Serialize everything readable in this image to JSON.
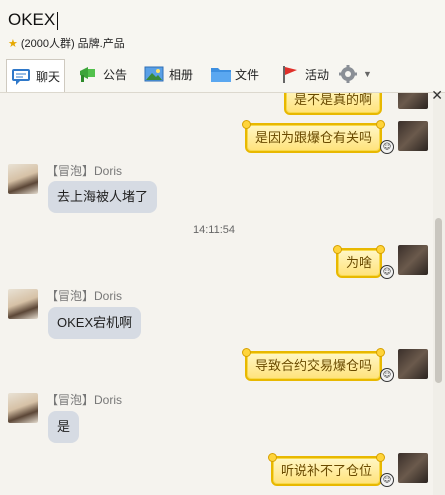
{
  "window": {
    "group_name": "OKEX",
    "member_count": "(2000人群)",
    "group_tags": "品牌.产品"
  },
  "toolbar": {
    "items": [
      {
        "label": "聊天",
        "icon": "chat-icon"
      },
      {
        "label": "公告",
        "icon": "announcement-icon"
      },
      {
        "label": "相册",
        "icon": "photo-album-icon"
      },
      {
        "label": "文件",
        "icon": "folder-icon"
      },
      {
        "label": "活动",
        "icon": "flag-icon"
      }
    ],
    "settings_icon": "gear-icon"
  },
  "messages": [
    {
      "side": "right",
      "text": "是不是真的啊"
    },
    {
      "side": "right",
      "text": "是因为跟爆仓有关吗"
    },
    {
      "side": "left",
      "sender": "【冒泡】Doris",
      "text": "去上海被人堵了"
    },
    {
      "side": "time",
      "text": "14:11:54"
    },
    {
      "side": "right",
      "text": "为啥"
    },
    {
      "side": "left",
      "sender": "【冒泡】Doris",
      "text": "OKEX宕机啊"
    },
    {
      "side": "right",
      "text": "导致合约交易爆仓吗"
    },
    {
      "side": "left",
      "sender": "【冒泡】Doris",
      "text": "是"
    },
    {
      "side": "right",
      "text": "听说补不了仓位"
    }
  ],
  "colors": {
    "bubble_left": "#d6dbe3",
    "bubble_right_fill": "#ffe27a",
    "bubble_right_border": "#e8b800"
  }
}
